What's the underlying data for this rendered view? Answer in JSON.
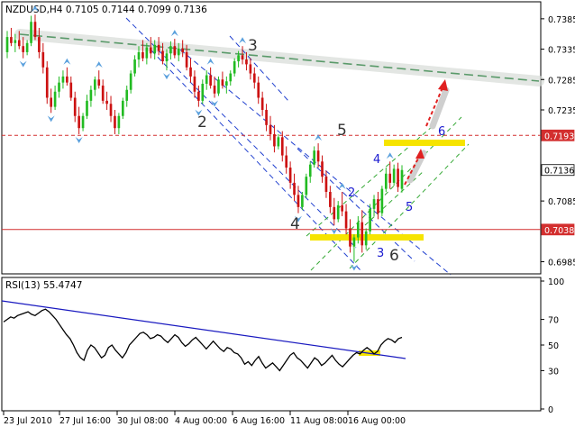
{
  "chart_data": {
    "type": "candlestick",
    "main": {
      "header": "NZDUSD,H4  0.7105 0.7144 0.7099 0.7136",
      "ylim": [
        0.6968,
        0.741
      ],
      "y_ticks": [
        "0.7385",
        "0.7335",
        "0.7285",
        "0.7235",
        "0.7193",
        "0.7136",
        "0.7085",
        "0.7038",
        "0.6985"
      ],
      "price_markers": [
        {
          "value": 0.7193,
          "label": "0.7193",
          "color": "#d32f2f",
          "style": "dashed"
        },
        {
          "value": 0.7038,
          "label": "0.7038",
          "color": "#d32f2f",
          "style": "solid"
        },
        {
          "value": 0.7136,
          "label": "0.7136",
          "color": "#ffffff",
          "style": "current"
        }
      ],
      "wave_labels": [
        {
          "text": "3",
          "color": "#333333"
        },
        {
          "text": "2",
          "color": "#333333"
        },
        {
          "text": "5",
          "color": "#333333"
        },
        {
          "text": "4",
          "color": "#333333"
        },
        {
          "text": "6",
          "color": "#333333"
        },
        {
          "text": "4",
          "color": "#1a1ad0"
        },
        {
          "text": "2",
          "color": "#1a1ad0"
        },
        {
          "text": "6",
          "color": "#1a1ad0"
        },
        {
          "text": "5",
          "color": "#1a1ad0"
        },
        {
          "text": "3",
          "color": "#1a1ad0"
        }
      ],
      "candles": [
        [
          0.733,
          0.7365,
          0.732,
          0.7355
        ],
        [
          0.7355,
          0.737,
          0.734,
          0.7345
        ],
        [
          0.7345,
          0.736,
          0.733,
          0.735
        ],
        [
          0.735,
          0.7365,
          0.7335,
          0.734
        ],
        [
          0.734,
          0.7355,
          0.732,
          0.733
        ],
        [
          0.733,
          0.735,
          0.7325,
          0.7345
        ],
        [
          0.7345,
          0.739,
          0.734,
          0.738
        ],
        [
          0.738,
          0.7392,
          0.735,
          0.7355
        ],
        [
          0.7355,
          0.737,
          0.732,
          0.733
        ],
        [
          0.733,
          0.7345,
          0.7295,
          0.7305
        ],
        [
          0.7305,
          0.7315,
          0.7245,
          0.7255
        ],
        [
          0.7255,
          0.727,
          0.723,
          0.724
        ],
        [
          0.724,
          0.7275,
          0.7235,
          0.7265
        ],
        [
          0.7265,
          0.729,
          0.7255,
          0.728
        ],
        [
          0.728,
          0.73,
          0.727,
          0.729
        ],
        [
          0.729,
          0.7305,
          0.7275,
          0.728
        ],
        [
          0.728,
          0.729,
          0.725,
          0.7255
        ],
        [
          0.7255,
          0.7265,
          0.7215,
          0.7225
        ],
        [
          0.7225,
          0.724,
          0.7195,
          0.7205
        ],
        [
          0.7205,
          0.723,
          0.72,
          0.7225
        ],
        [
          0.7225,
          0.726,
          0.722,
          0.725
        ],
        [
          0.725,
          0.7275,
          0.724,
          0.7268
        ],
        [
          0.7268,
          0.729,
          0.7258,
          0.7285
        ],
        [
          0.7285,
          0.73,
          0.727,
          0.7275
        ],
        [
          0.7275,
          0.7285,
          0.7245,
          0.725
        ],
        [
          0.725,
          0.7265,
          0.7235,
          0.7245
        ],
        [
          0.7245,
          0.7258,
          0.7215,
          0.7225
        ],
        [
          0.7225,
          0.7235,
          0.7195,
          0.7205
        ],
        [
          0.7205,
          0.723,
          0.7195,
          0.7225
        ],
        [
          0.7225,
          0.7255,
          0.722,
          0.725
        ],
        [
          0.725,
          0.7275,
          0.724,
          0.7268
        ],
        [
          0.7268,
          0.73,
          0.7262,
          0.7295
        ],
        [
          0.7295,
          0.7325,
          0.729,
          0.7318
        ],
        [
          0.7318,
          0.734,
          0.7305,
          0.733
        ],
        [
          0.733,
          0.735,
          0.7315,
          0.732
        ],
        [
          0.732,
          0.7345,
          0.731,
          0.7338
        ],
        [
          0.7338,
          0.7355,
          0.732,
          0.7328
        ],
        [
          0.7328,
          0.735,
          0.7318,
          0.7342
        ],
        [
          0.7342,
          0.7355,
          0.7325,
          0.7332
        ],
        [
          0.7332,
          0.7345,
          0.731,
          0.7315
        ],
        [
          0.7315,
          0.7335,
          0.73,
          0.7328
        ],
        [
          0.7328,
          0.7348,
          0.7318,
          0.734
        ],
        [
          0.734,
          0.7352,
          0.732,
          0.7325
        ],
        [
          0.7325,
          0.7345,
          0.7315,
          0.7336
        ],
        [
          0.7336,
          0.735,
          0.7322,
          0.733
        ],
        [
          0.733,
          0.7342,
          0.73,
          0.7305
        ],
        [
          0.7305,
          0.732,
          0.728,
          0.729
        ],
        [
          0.729,
          0.73,
          0.7255,
          0.7265
        ],
        [
          0.7265,
          0.7275,
          0.724,
          0.725
        ],
        [
          0.725,
          0.7285,
          0.7245,
          0.7278
        ],
        [
          0.7278,
          0.73,
          0.7268,
          0.7292
        ],
        [
          0.7292,
          0.7305,
          0.727,
          0.7275
        ],
        [
          0.7275,
          0.729,
          0.7255,
          0.7262
        ],
        [
          0.7262,
          0.729,
          0.7258,
          0.7285
        ],
        [
          0.7285,
          0.7298,
          0.727,
          0.7275
        ],
        [
          0.7275,
          0.729,
          0.7262,
          0.7282
        ],
        [
          0.7282,
          0.73,
          0.7275,
          0.7295
        ],
        [
          0.7295,
          0.732,
          0.729,
          0.7315
        ],
        [
          0.7315,
          0.7332,
          0.7305,
          0.7325
        ],
        [
          0.7325,
          0.734,
          0.731,
          0.7318
        ],
        [
          0.7318,
          0.733,
          0.73,
          0.731
        ],
        [
          0.731,
          0.732,
          0.7285,
          0.7295
        ],
        [
          0.7295,
          0.7305,
          0.727,
          0.728
        ],
        [
          0.728,
          0.729,
          0.7245,
          0.7255
        ],
        [
          0.7255,
          0.7265,
          0.7225,
          0.7235
        ],
        [
          0.7235,
          0.7245,
          0.72,
          0.721
        ],
        [
          0.721,
          0.7225,
          0.7185,
          0.7195
        ],
        [
          0.7195,
          0.721,
          0.7165,
          0.7175
        ],
        [
          0.7175,
          0.7195,
          0.717,
          0.719
        ],
        [
          0.719,
          0.72,
          0.715,
          0.716
        ],
        [
          0.716,
          0.7175,
          0.713,
          0.714
        ],
        [
          0.714,
          0.715,
          0.7105,
          0.7115
        ],
        [
          0.7115,
          0.713,
          0.7085,
          0.7095
        ],
        [
          0.7095,
          0.711,
          0.7065,
          0.7075
        ],
        [
          0.7075,
          0.71,
          0.707,
          0.7095
        ],
        [
          0.7095,
          0.713,
          0.709,
          0.7125
        ],
        [
          0.7125,
          0.715,
          0.7115,
          0.7145
        ],
        [
          0.7145,
          0.7175,
          0.714,
          0.7168
        ],
        [
          0.7168,
          0.718,
          0.714,
          0.715
        ],
        [
          0.715,
          0.716,
          0.7115,
          0.7125
        ],
        [
          0.7125,
          0.7135,
          0.709,
          0.71
        ],
        [
          0.71,
          0.711,
          0.7065,
          0.7075
        ],
        [
          0.7075,
          0.709,
          0.7045,
          0.7055
        ],
        [
          0.7055,
          0.7085,
          0.705,
          0.7078
        ],
        [
          0.7078,
          0.71,
          0.706,
          0.7068
        ],
        [
          0.7068,
          0.708,
          0.703,
          0.704
        ],
        [
          0.704,
          0.7055,
          0.7,
          0.701
        ],
        [
          0.701,
          0.703,
          0.6985,
          0.7025
        ],
        [
          0.7025,
          0.706,
          0.7015,
          0.705
        ],
        [
          0.705,
          0.707,
          0.7,
          0.7012
        ],
        [
          0.7012,
          0.704,
          0.7005,
          0.7035
        ],
        [
          0.7035,
          0.708,
          0.703,
          0.7072
        ],
        [
          0.7072,
          0.7095,
          0.706,
          0.7088
        ],
        [
          0.7088,
          0.71,
          0.7055,
          0.7065
        ],
        [
          0.7065,
          0.711,
          0.706,
          0.7105
        ],
        [
          0.7105,
          0.714,
          0.71,
          0.713
        ],
        [
          0.713,
          0.715,
          0.7105,
          0.7115
        ],
        [
          0.7115,
          0.7145,
          0.711,
          0.7138
        ],
        [
          0.7138,
          0.7148,
          0.71,
          0.7108
        ],
        [
          0.7105,
          0.7144,
          0.7099,
          0.7136
        ]
      ]
    },
    "rsi": {
      "header": "RSI(13) 55.4747",
      "ylim": [
        0,
        100
      ],
      "y_ticks": [
        "100",
        "70",
        "50",
        "30",
        "0"
      ],
      "values": [
        68,
        70,
        72,
        71,
        73,
        74,
        75,
        76,
        74,
        73,
        75,
        77,
        78,
        76,
        73,
        70,
        66,
        62,
        58,
        55,
        50,
        44,
        40,
        38,
        46,
        50,
        48,
        44,
        40,
        42,
        48,
        50,
        46,
        43,
        40,
        44,
        50,
        53,
        56,
        59,
        60,
        58,
        55,
        56,
        58,
        57,
        54,
        52,
        55,
        58,
        56,
        52,
        49,
        51,
        54,
        56,
        53,
        50,
        47,
        50,
        53,
        50,
        47,
        45,
        48,
        47,
        44,
        43,
        40,
        35,
        37,
        34,
        38,
        41,
        36,
        32,
        34,
        36,
        33,
        30,
        34,
        38,
        42,
        44,
        40,
        38,
        35,
        32,
        36,
        40,
        38,
        34,
        36,
        39,
        42,
        38,
        35,
        33,
        36,
        39,
        42,
        44,
        43,
        46,
        48,
        46,
        43,
        45,
        50,
        53,
        55,
        54,
        52,
        55,
        56
      ]
    },
    "x_ticks": [
      "23 Jul 2010",
      "27 Jul 16:00",
      "30 Jul 08:00",
      "4 Aug 00:00",
      "6 Aug 16:00",
      "11 Aug 08:00",
      "16 Aug 00:00"
    ],
    "colors": {
      "bull": "#22bb22",
      "bear": "#cc1111",
      "level": "#d32f2f",
      "channel": "#1f3fcf",
      "fib": "#33a833",
      "trend": "#5a9a6a",
      "rsi_line": "#000000",
      "rsi_trend": "#1a1ac0",
      "highlight": "#f6e400",
      "arrow": "#e02020",
      "fractal": "#5aa0dd"
    }
  }
}
